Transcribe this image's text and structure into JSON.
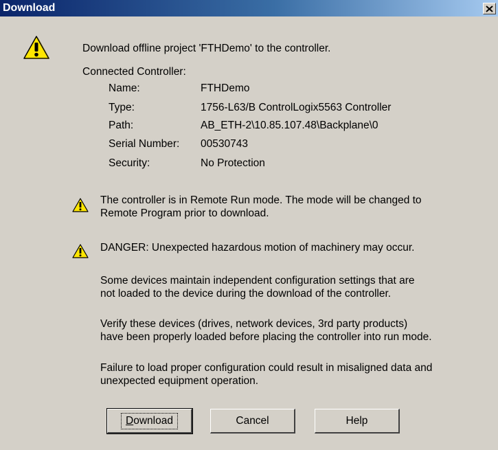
{
  "window": {
    "title": "Download",
    "close_glyph": "×"
  },
  "header": {
    "message": "Download offline project 'FTHDemo' to the controller.",
    "connected_label": "Connected Controller:",
    "icon": "warning-triangle-large-icon"
  },
  "controller": {
    "rows": [
      {
        "label": "Name:",
        "value": "FTHDemo"
      },
      {
        "label": "Type:",
        "value": "1756-L63/B ControlLogix5563 Controller"
      },
      {
        "label": "Path:",
        "value": "AB_ETH-2\\10.85.107.48\\Backplane\\0"
      },
      {
        "label": "Serial Number:",
        "value": "00530743"
      },
      {
        "label": "Security:",
        "value": "No Protection"
      }
    ]
  },
  "warnings": {
    "mode_line1": "The controller is in Remote Run mode. The mode will be changed to",
    "mode_line2": "Remote Program prior to download.",
    "danger": "DANGER: Unexpected hazardous motion of machinery may occur.",
    "para1_line1": "Some devices maintain independent configuration settings that are",
    "para1_line2": "not loaded to the device during the download of the controller.",
    "para2_line1": "Verify these devices (drives, network devices, 3rd party products)",
    "para2_line2": "have been properly loaded before placing the controller into run mode.",
    "para3_line1": "Failure to load proper configuration could result in misaligned data and",
    "para3_line2": "unexpected equipment operation.",
    "icon": "warning-triangle-small-icon"
  },
  "buttons": {
    "download": "Download",
    "cancel": "Cancel",
    "help": "Help"
  },
  "colors": {
    "titlebar_start": "#0a246a",
    "titlebar_end": "#a6caf0",
    "dialog_bg": "#d4d0c8",
    "warning_yellow": "#ffe600"
  }
}
